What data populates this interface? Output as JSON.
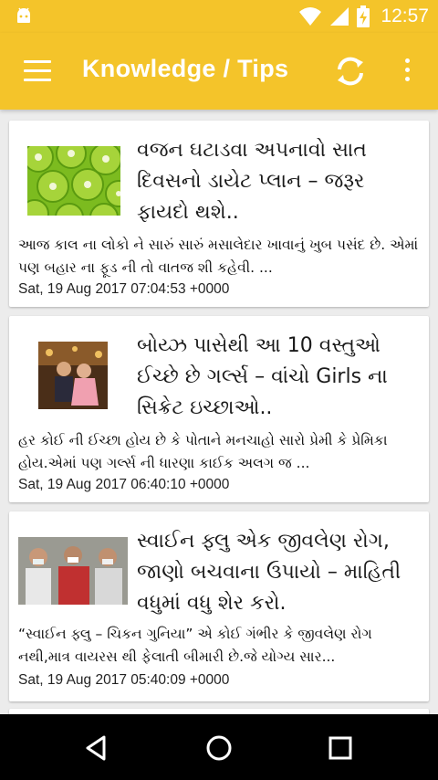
{
  "status_bar": {
    "time": "12:57",
    "icons": [
      "android-icon",
      "wifi-icon",
      "signal-icon",
      "battery-charging-icon"
    ]
  },
  "app_bar": {
    "title": "Knowledge / Tips",
    "icons": [
      "menu-icon",
      "refresh-icon",
      "more-vert-icon"
    ]
  },
  "articles": [
    {
      "title": "વજન ઘટાડવા અપનાવો સાત દિવસનો ડાયેટ પ્લાન – જરૂર ફાયદો થશે..",
      "excerpt": "આજ કાલ ના લોકો ને સારું સારું મસાલેદાર ખાવાનું ખુબ પસંદ છે. એમાં પણ બહાર ના ફૂડ ની તો વાતજ શી કહેવી. ...",
      "date": "Sat, 19 Aug 2017 07:04:53 +0000",
      "thumb": "kiwi-slices-image"
    },
    {
      "title": "બોય્ઝ પાસેથી આ 10 વસ્તુઓ ઈચ્છે છે ગર્લ્સ – વાંચો Girls ના સિક્રેટ ઇચ્છાઓ..",
      "excerpt": "હર કોઈ ની ઈચ્છા હોય છે કે પોતાને મનચાહો સારો પ્રેમી કે પ્રેમિકા હોય.એમાં પણ ગર્લ્સ ની ધારણા કાઈક અલગ જ ...",
      "date": "Sat, 19 Aug 2017 06:40:10 +0000",
      "thumb": "couple-image"
    },
    {
      "title": "સ્વાઈન ફ્લુ એક જીવલેણ રોગ, જાણો બચવાના ઉપાયો – માહિતી વધુમાં વધુ શેર કરો.",
      "excerpt": "“સ્વાઈન ફ્લુ – ચિકન ગુનિયા” એ કોઈ ગંભીર કે જીવલેણ રોગ નથી,માત્ર વાયરસ થી ફેલાતી બીમારી છે.જે યોગ્ય સાર...",
      "date": "Sat, 19 Aug 2017 05:40:09 +0000",
      "thumb": "masked-people-image"
    }
  ],
  "nav_bar": {
    "icons": [
      "back-icon",
      "home-icon",
      "recents-icon"
    ]
  },
  "colors": {
    "primary": "#f4c42a",
    "background": "#ececec",
    "card": "#ffffff",
    "nav": "#000000"
  }
}
